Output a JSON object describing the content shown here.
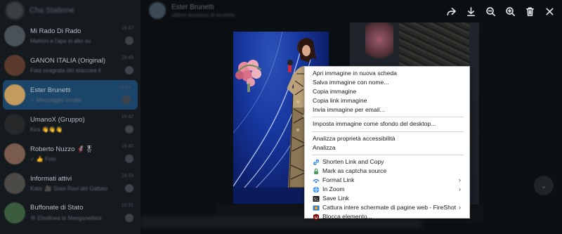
{
  "sidebar": {
    "header_title": "Cha Statione",
    "chats": [
      {
        "name": "Mi Rado Di Rado",
        "preview": "Mattoni e l'ape in alto su",
        "time": "19:47",
        "avatar_color": "#4a5157",
        "active": false
      },
      {
        "name": "GANON ITALIA (Original)",
        "preview": "Fata seagrata del staccare il",
        "time": "19:45",
        "avatar_color": "#5a3b2c",
        "active": false
      },
      {
        "name": "Ester Brunetti",
        "preview": "✓ Messaggio vocale",
        "time": "19:44",
        "avatar_color": "#c49a5d",
        "active": true
      },
      {
        "name": "UmanoX (Gruppo)",
        "preview": "Kira 👋👋👋",
        "time": "19:42",
        "avatar_color": "#26282a",
        "active": false
      },
      {
        "name": "Roberto Nuzzo 🦸‍♂️🎖",
        "preview": "✓ 👍 Foto",
        "time": "19:40",
        "avatar_color": "#7a5c4f",
        "active": false
      },
      {
        "name": "Informati attivi",
        "preview": "Kata: 🎥 Stasi Ravi del Gattaio",
        "time": "19:33",
        "avatar_color": "#4b4a46",
        "active": false
      },
      {
        "name": "Buffonate di Stato",
        "preview": "Ⓜ Elsolinea la Manganellata",
        "time": "19:31",
        "avatar_color": "#3b5c3e",
        "active": false
      }
    ]
  },
  "header": {
    "name": "Ester Brunetti",
    "status": "ultimo accesso di recente"
  },
  "viewer_toolbar": [
    {
      "icon": "share-icon",
      "label": "Condividi"
    },
    {
      "icon": "download-icon",
      "label": "Scarica"
    },
    {
      "icon": "zoom-out-icon",
      "label": "Riduci"
    },
    {
      "icon": "zoom-in-icon",
      "label": "Ingrandisci"
    },
    {
      "icon": "delete-icon",
      "label": "Elimina"
    },
    {
      "icon": "close-icon",
      "label": "Chiudi"
    }
  ],
  "context_menu": {
    "group1": [
      "Apri immagine in nuova scheda",
      "Salva immagine con nome...",
      "Copia immagine",
      "Copia link immagine",
      "Invia immagine per email..."
    ],
    "group2": [
      "Imposta immagine come sfondo del desktop..."
    ],
    "group3": [
      "Analizza proprietà accessibilità",
      "Analizza"
    ],
    "group4": [
      {
        "label": "Shorten Link and Copy",
        "icon": "link-icon",
        "submenu": false
      },
      {
        "label": "Mark as captcha source",
        "icon": "captcha-icon",
        "submenu": false
      },
      {
        "label": "Format Link",
        "icon": "format-link-icon",
        "submenu": true
      },
      {
        "label": "In Zoom",
        "icon": "zoom-globe-icon",
        "submenu": true
      },
      {
        "label": "Save Link",
        "icon": "save-link-icon",
        "submenu": false
      },
      {
        "label": "Cattura intere schermate di pagine web - FireShot",
        "icon": "fireshot-icon",
        "submenu": true
      },
      {
        "label": "Blocca elemento...",
        "icon": "ublock-icon",
        "submenu": false
      }
    ]
  },
  "colors": {
    "sidebar_bg": "#151a1f",
    "active_chat": "#1c4669",
    "menu_bg": "#ffffff",
    "stage_bg": "#1738a0"
  }
}
